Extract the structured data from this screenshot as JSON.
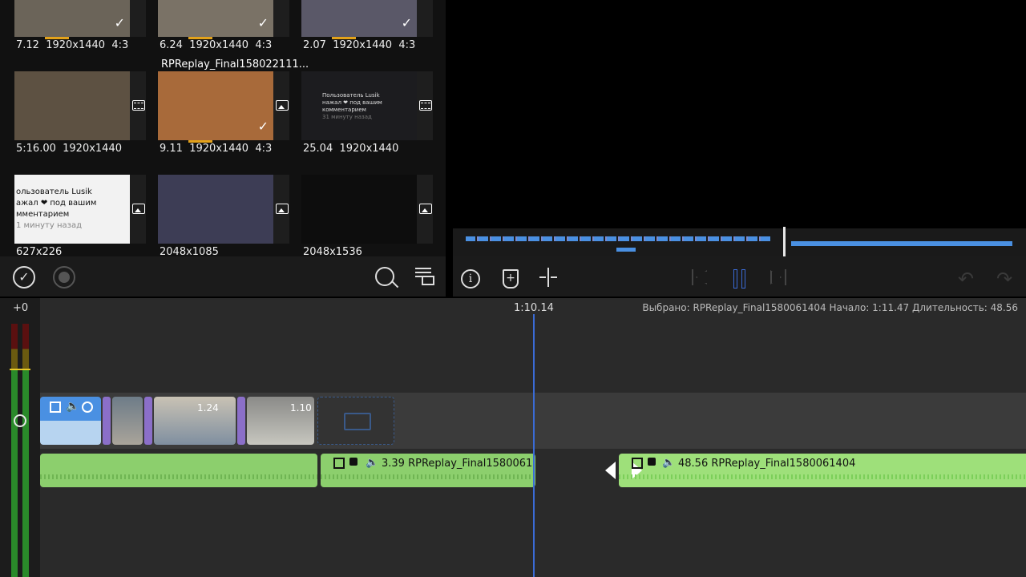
{
  "media": {
    "tiles": [
      {
        "row": 0,
        "col": 0,
        "meta": "7.12  1920x1440  4:3",
        "checked": true,
        "type": "none",
        "thumb": "#6b6459"
      },
      {
        "row": 0,
        "col": 1,
        "meta": "6.24  1920x1440  4:3",
        "checked": true,
        "type": "none",
        "thumb": "#7a7266"
      },
      {
        "row": 0,
        "col": 2,
        "meta": "2.07  1920x1440  4:3",
        "checked": true,
        "type": "none",
        "thumb": "#5a5868"
      },
      {
        "row": 1,
        "col": 0,
        "meta": "5:16.00  1920x1440",
        "checked": false,
        "type": "video",
        "thumb": "#5d5142"
      },
      {
        "row": 1,
        "col": 1,
        "meta": "9.11  1920x1440  4:3",
        "checked": true,
        "type": "photo",
        "thumb": "#a86a3a",
        "name": "RPReplay_Final158022111..."
      },
      {
        "row": 1,
        "col": 2,
        "meta": "25.04  1920x1440",
        "checked": false,
        "type": "video",
        "thumb": "#1c1c1f"
      },
      {
        "row": 2,
        "col": 0,
        "meta": "627x226",
        "checked": false,
        "type": "photo",
        "thumb": "#f2f2f2"
      },
      {
        "row": 2,
        "col": 1,
        "meta": "2048x1085",
        "checked": false,
        "type": "photo",
        "thumb": "#3d3d55"
      },
      {
        "row": 2,
        "col": 2,
        "meta": "2048x1536",
        "checked": false,
        "type": "photo",
        "thumb": "#0d0d0d"
      }
    ],
    "thumb_text": {
      "t5_l1": "Пользователь Lusik",
      "t5_l2": "нажал ❤ под вашим",
      "t5_l3": "комментарием",
      "t5_l4": "31 минуту назад",
      "t6_l1": "ользователь Lusik",
      "t6_l2": "ажал ❤ под вашим",
      "t6_l3": "мментарием",
      "t6_l4": "1 минуту назад"
    }
  },
  "toolbar": {
    "left_icons": [
      "checkmark-circle-icon",
      "record-icon",
      "search-icon",
      "list-settings-icon"
    ],
    "right_icons": [
      "info-icon",
      "add-marker-icon",
      "split-icon",
      "skip-back-icon",
      "pause-icon",
      "skip-forward-icon",
      "undo-icon",
      "redo-icon"
    ]
  },
  "timeline": {
    "offset_label": "+0",
    "playhead_time": "1:10.14",
    "selection_info": "Выбрано: RPReplay_Final1580061404 Начало: 1:11.47 Длительность: 48.56",
    "video_clip_labels": [
      "1.24",
      "1.10"
    ],
    "audio_clip1_label": "3.39   RPReplay_Final1580061",
    "audio_clip2_label": "48.56   RPReplay_Final1580061404"
  },
  "colors": {
    "accent_blue": "#4a90e2",
    "audio_green": "#8ccf6d",
    "selected_green": "#9ee07a",
    "playhead": "#3a6bd6",
    "progress_orange": "#e3a21a"
  }
}
